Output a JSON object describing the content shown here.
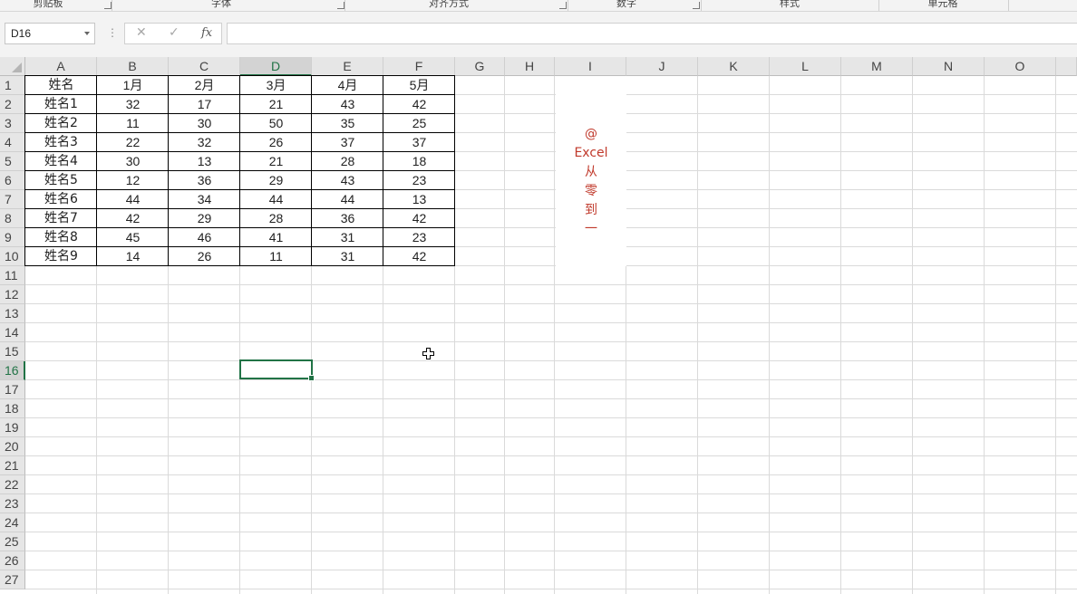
{
  "ribbon": {
    "groups": [
      "剪贴板",
      "字体",
      "对齐方式",
      "数字",
      "样式",
      "单元格"
    ]
  },
  "formula_bar": {
    "name_box": "D16",
    "cancel_icon": "✕",
    "enter_icon": "✓",
    "fx_label": "fx",
    "formula": ""
  },
  "sheet": {
    "columns": [
      "A",
      "B",
      "C",
      "D",
      "E",
      "F",
      "G",
      "H",
      "I",
      "J",
      "K",
      "L",
      "M",
      "N",
      "O"
    ],
    "rows": [
      "1",
      "2",
      "3",
      "4",
      "5",
      "6",
      "7",
      "8",
      "9",
      "10",
      "11",
      "12",
      "13",
      "14",
      "15",
      "16",
      "17",
      "18",
      "19",
      "20",
      "21",
      "22",
      "23",
      "24",
      "25",
      "26",
      "27"
    ],
    "active_cell": "D16",
    "table": {
      "header": [
        "姓名",
        "1月",
        "2月",
        "3月",
        "4月",
        "5月"
      ],
      "rows": [
        [
          "姓名1",
          "32",
          "17",
          "21",
          "43",
          "42"
        ],
        [
          "姓名2",
          "11",
          "30",
          "50",
          "35",
          "25"
        ],
        [
          "姓名3",
          "22",
          "32",
          "26",
          "37",
          "37"
        ],
        [
          "姓名4",
          "30",
          "13",
          "21",
          "28",
          "18"
        ],
        [
          "姓名5",
          "12",
          "36",
          "29",
          "43",
          "23"
        ],
        [
          "姓名6",
          "44",
          "34",
          "44",
          "44",
          "13"
        ],
        [
          "姓名7",
          "42",
          "29",
          "28",
          "36",
          "42"
        ],
        [
          "姓名8",
          "45",
          "46",
          "41",
          "31",
          "23"
        ],
        [
          "姓名9",
          "14",
          "26",
          "11",
          "31",
          "42"
        ]
      ]
    },
    "note": [
      "@",
      "Excel",
      "从",
      "零",
      "到",
      "一"
    ],
    "note_color": "#c0392b",
    "accent_color": "#217346"
  }
}
